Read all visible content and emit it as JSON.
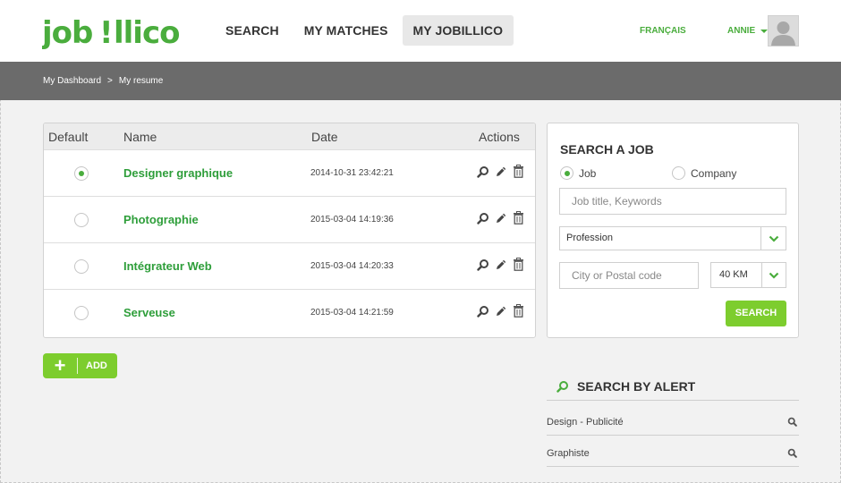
{
  "header": {
    "logo_text": "job!llico",
    "nav": [
      {
        "label": "SEARCH"
      },
      {
        "label": "MY MATCHES"
      },
      {
        "label": "MY JOBILLICO",
        "active": true
      }
    ],
    "language": "FRANÇAIS",
    "user_name": "ANNIE"
  },
  "breadcrumb": {
    "items": [
      "My Dashboard",
      "My resume"
    ],
    "separator": ">"
  },
  "resumes": {
    "columns": {
      "default": "Default",
      "name": "Name",
      "date": "Date",
      "actions": "Actions"
    },
    "rows": [
      {
        "name": "Designer graphique",
        "date": "2014-10-31 23:42:21",
        "is_default": true
      },
      {
        "name": "Photographie",
        "date": "2015-03-04 14:19:36",
        "is_default": false
      },
      {
        "name": "Intégrateur Web",
        "date": "2015-03-04 14:20:33",
        "is_default": false
      },
      {
        "name": "Serveuse",
        "date": "2015-03-04 14:21:59",
        "is_default": false
      }
    ],
    "add_label": "ADD"
  },
  "search_job": {
    "title": "SEARCH A JOB",
    "type_job": "Job",
    "type_company": "Company",
    "selected_type": "Job",
    "keywords_placeholder": "Job title, Keywords",
    "profession_value": "Profession",
    "location_placeholder": "City or Postal code",
    "distance_value": "40 KM",
    "search_label": "SEARCH"
  },
  "alerts": {
    "title": "SEARCH BY ALERT",
    "items": [
      {
        "label": "Design - Publicité"
      },
      {
        "label": "Graphiste"
      }
    ]
  },
  "colors": {
    "brand_green": "#4aad3d",
    "button_green": "#7dcd2e",
    "breadcrumb_bar": "#6b6b6b"
  },
  "icons": [
    "search-icon",
    "edit-pencil-icon",
    "trash-icon",
    "chevron-down-icon",
    "avatar-placeholder-icon",
    "plus-icon"
  ]
}
